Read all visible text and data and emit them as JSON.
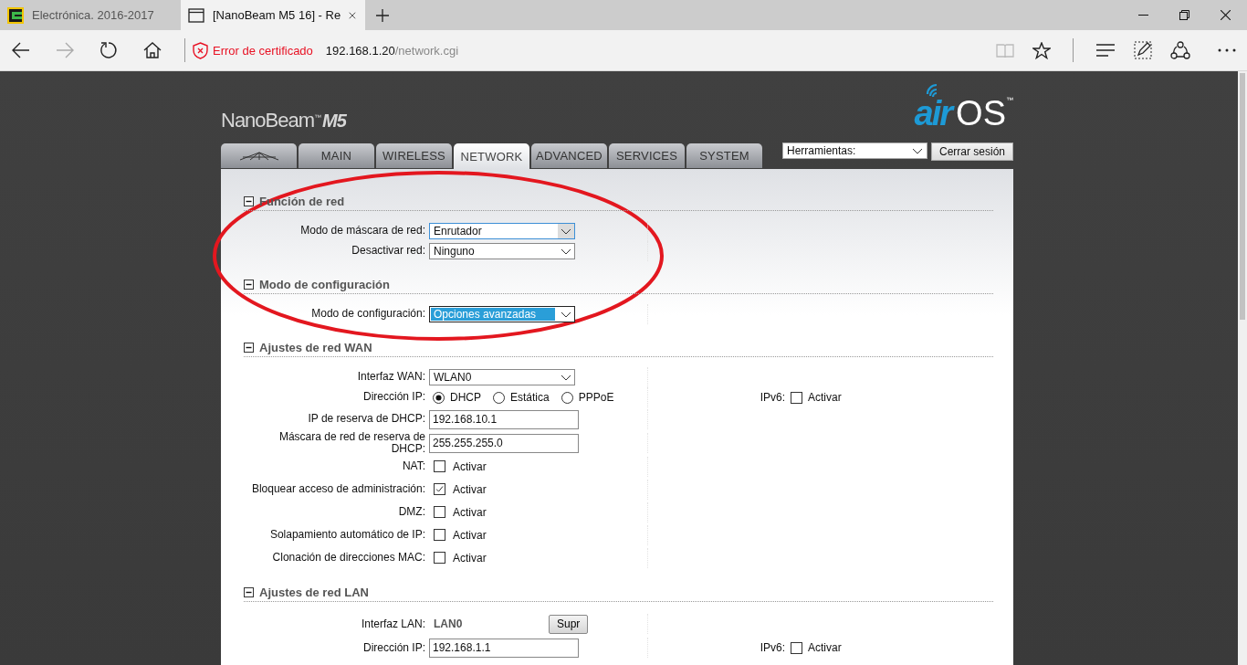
{
  "browser": {
    "tabs": [
      {
        "title": "Electrónica. 2016-2017",
        "kind": "site",
        "selected": false
      },
      {
        "title": "[NanoBeam M5 16] - Re",
        "kind": "page",
        "selected": true
      }
    ],
    "address": {
      "warning": "Error de certificado",
      "host": "192.168.1.20",
      "path": "/network.cgi"
    }
  },
  "header": {
    "product": "NanoBeam",
    "product_mark": "™",
    "model": "M5",
    "logo_prefix": "air",
    "logo_suffix": "OS",
    "logo_mark": "™"
  },
  "nav_tabs": [
    {
      "kind": "icon",
      "selected": false
    },
    {
      "kind": "text",
      "label": "MAIN",
      "selected": false
    },
    {
      "kind": "text",
      "label": "WIRELESS",
      "selected": false
    },
    {
      "kind": "text",
      "label": "NETWORK",
      "selected": true
    },
    {
      "kind": "text",
      "label": "ADVANCED",
      "selected": false
    },
    {
      "kind": "text",
      "label": "SERVICES",
      "selected": false
    },
    {
      "kind": "text",
      "label": "SYSTEM",
      "selected": false
    }
  ],
  "tools": {
    "select": "Herramientas:",
    "logout": "Cerrar sesión"
  },
  "sections": [
    {
      "title": "Función de red",
      "expanded": true,
      "rows": [
        {
          "kind": "select",
          "label": "Modo de máscara de red:",
          "value": "Enrutador",
          "focused": true,
          "highlighted": false
        },
        {
          "kind": "select",
          "label": "Desactivar red:",
          "value": "Ninguno",
          "focused": false,
          "highlighted": false
        }
      ]
    },
    {
      "title": "Modo de configuración",
      "expanded": true,
      "rows": [
        {
          "kind": "select",
          "label": "Modo de configuración:",
          "value": "Opciones avanzadas",
          "focused": false,
          "highlighted": true
        }
      ]
    },
    {
      "title": "Ajustes de red WAN",
      "expanded": true,
      "rows": [
        {
          "kind": "select",
          "label": "Interfaz WAN:",
          "value": "WLAN0",
          "focused": false,
          "highlighted": false
        },
        {
          "kind": "radio",
          "label": "Dirección IP:",
          "options": [
            {
              "label": "DHCP",
              "selected": true
            },
            {
              "label": "Estática",
              "selected": false
            },
            {
              "label": "PPPoE",
              "selected": false
            }
          ],
          "side": {
            "label": "IPv6:",
            "option": "Activar",
            "checked": false
          }
        },
        {
          "kind": "text",
          "label": "IP de reserva de DHCP:",
          "value": "192.168.10.1"
        },
        {
          "kind": "text",
          "label": "Máscara de red de reserva de DHCP:",
          "value": "255.255.255.0"
        },
        {
          "kind": "checkbox",
          "label": "NAT:",
          "option": "Activar",
          "checked": false
        },
        {
          "kind": "checkbox",
          "label": "Bloquear acceso de administración:",
          "option": "Activar",
          "checked": true
        },
        {
          "kind": "checkbox",
          "label": "DMZ:",
          "option": "Activar",
          "checked": false
        },
        {
          "kind": "checkbox",
          "label": "Solapamiento automático de IP:",
          "option": "Activar",
          "checked": false
        },
        {
          "kind": "checkbox",
          "label": "Clonación de direcciones MAC:",
          "option": "Activar",
          "checked": false
        }
      ]
    },
    {
      "title": "Ajustes de red LAN",
      "expanded": true,
      "rows": [
        {
          "kind": "static",
          "label": "Interfaz LAN:",
          "value": "LAN0",
          "button": "Supr"
        },
        {
          "kind": "text",
          "label": "Dirección IP:",
          "value": "192.168.1.1",
          "side": {
            "label": "IPv6:",
            "option": "Activar",
            "checked": false
          }
        }
      ]
    }
  ]
}
